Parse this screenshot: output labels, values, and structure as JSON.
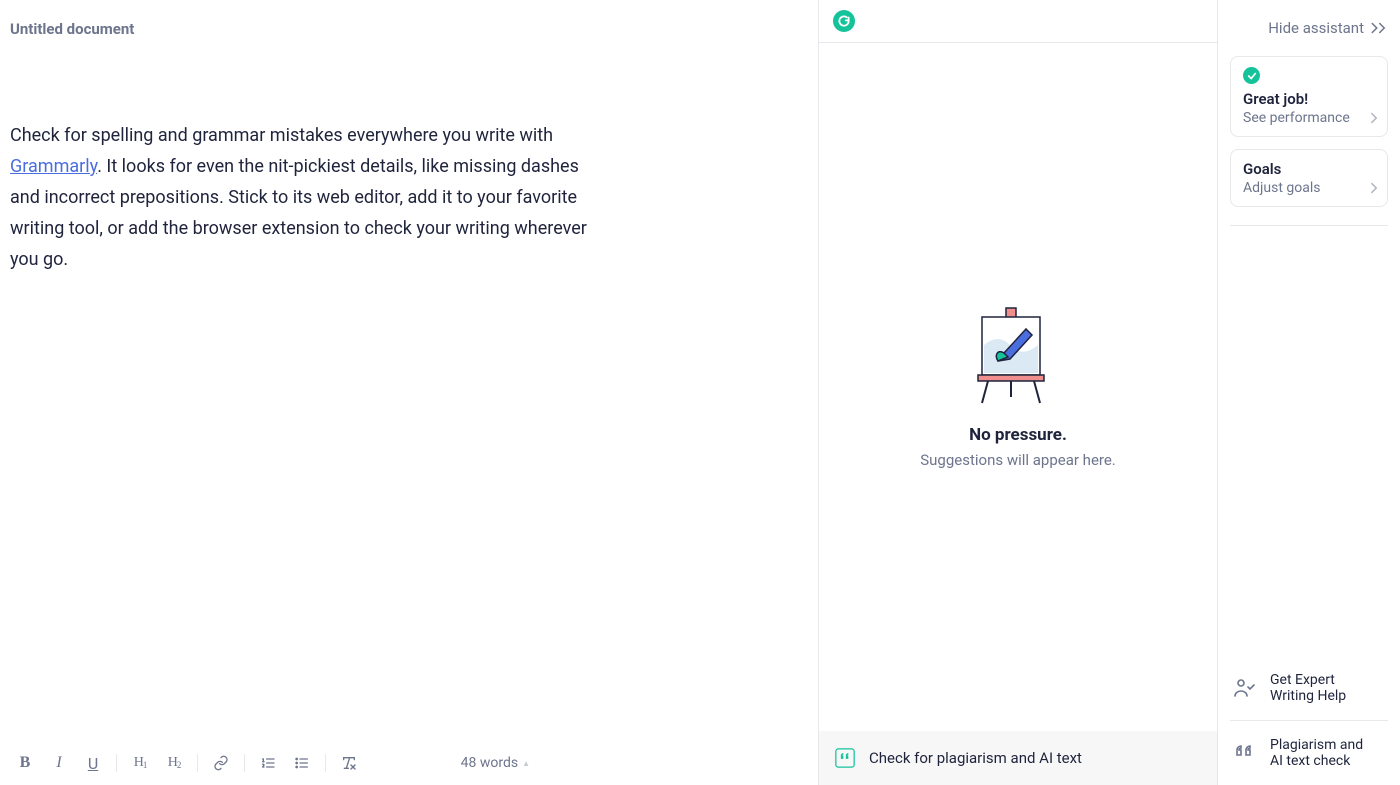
{
  "document": {
    "title": "Untitled document",
    "body_before_link": "Check for spelling and grammar mistakes everywhere you write with ",
    "link_text": "Grammarly",
    "body_after_link": ". It looks for even the nit-pickiest details, like missing dashes and incorrect prepositions. Stick to its web editor, add it to your favorite writing tool, or add the browser extension to check your writing wherever you go."
  },
  "toolbar": {
    "word_count": "48 words"
  },
  "suggestions": {
    "empty_title": "No pressure.",
    "empty_subtitle": "Suggestions will appear here.",
    "footer_label": "Check for plagiarism and AI text"
  },
  "assistant": {
    "hide_label": "Hide assistant",
    "cards": [
      {
        "badge": true,
        "title": "Great job!",
        "subtitle": "See performance"
      },
      {
        "badge": false,
        "title": "Goals",
        "subtitle": "Adjust goals"
      }
    ],
    "bottom": [
      {
        "line1": "Get Expert",
        "line2": "Writing Help",
        "icon": "expert"
      },
      {
        "line1": "Plagiarism and",
        "line2": "AI text check",
        "icon": "quotes"
      }
    ]
  }
}
